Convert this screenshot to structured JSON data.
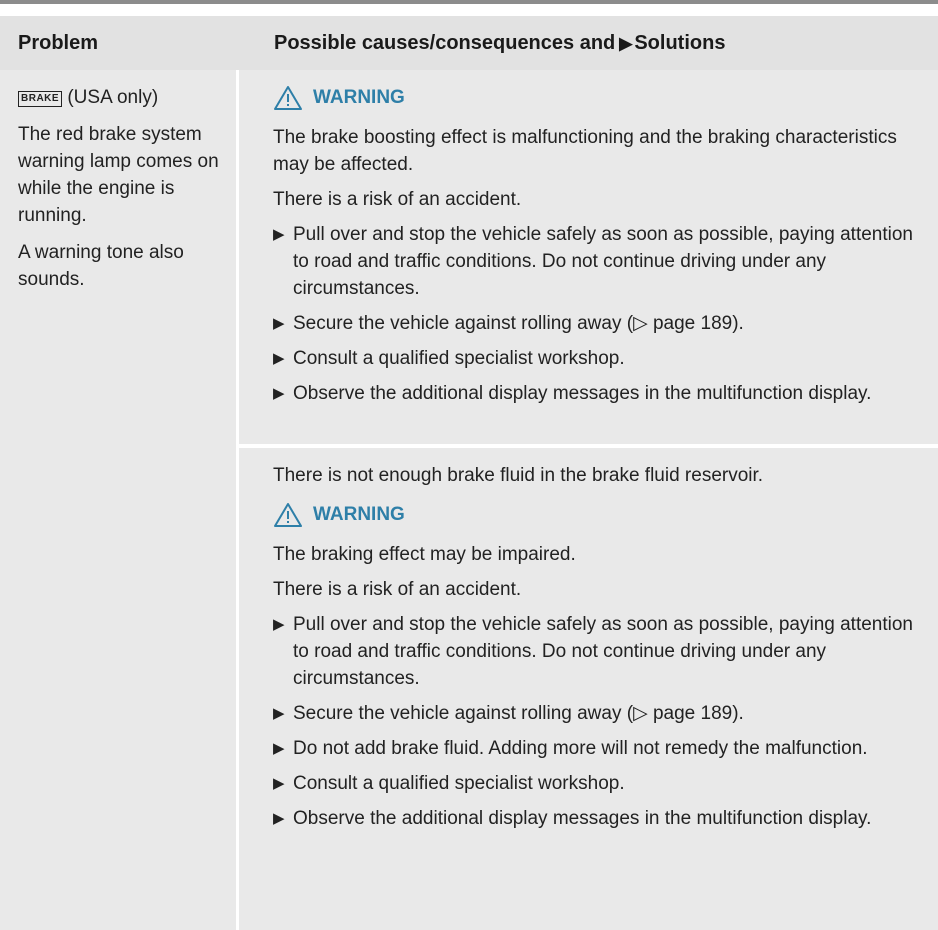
{
  "header": {
    "col1": "Problem",
    "col2_pre": "Possible causes/consequences and",
    "col2_arrow": "▶",
    "col2_post": "Solutions"
  },
  "problem": {
    "badge": "BRAKE",
    "region": "(USA only)",
    "paragraphs": [
      "The red brake system warning lamp comes on while the engine is running.",
      "A warning tone also sounds."
    ]
  },
  "section1": {
    "warning_label": "WARNING",
    "paragraphs": [
      "The brake boosting effect is malfunctioning and the braking characteristics may be affected.",
      "There is a risk of an accident."
    ],
    "steps": [
      "Pull over and stop the vehicle safely as soon as possible, paying attention to road and traffic conditions. Do not continue driving under any circumstances.",
      "Secure the vehicle against rolling away (▷ page 189).",
      "Consult a qualified specialist workshop.",
      "Observe the additional display messages in the multifunction display."
    ]
  },
  "section2": {
    "lead": "There is not enough brake fluid in the brake fluid reservoir.",
    "warning_label": "WARNING",
    "paragraphs": [
      "The braking effect may be impaired.",
      "There is a risk of an accident."
    ],
    "steps": [
      "Pull over and stop the vehicle safely as soon as possible, paying attention to road and traffic conditions. Do not continue driving under any circumstances.",
      "Secure the vehicle against rolling away (▷ page 189).",
      "Do not add brake fluid. Adding more will not remedy the malfunction.",
      "Consult a qualified specialist workshop.",
      "Observe the additional display messages in the multifunction display."
    ]
  },
  "icons": {
    "warning": "warning-triangle-icon",
    "step": "triangle-bullet-icon"
  },
  "colors": {
    "warning_accent": "#2e7fa8",
    "cell_background": "#e9e9e9",
    "header_background": "#e2e2e2"
  }
}
